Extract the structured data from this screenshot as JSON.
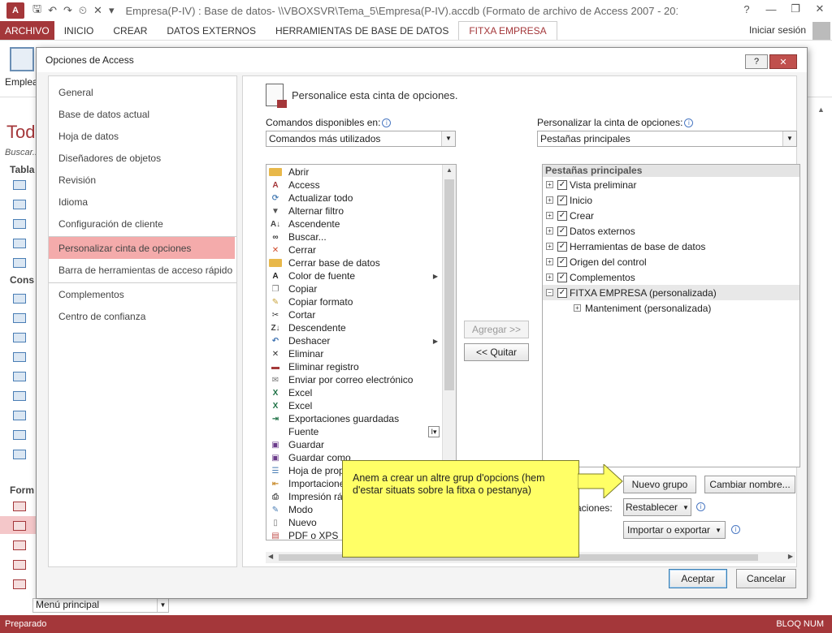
{
  "titlebar": {
    "app_logo": "A",
    "title": "Empresa(P-IV) : Base de datos- \\\\VBOXSVR\\Tema_5\\Empresa(P-IV).accdb (Formato de archivo de Access 2007 - 2013) - A...",
    "window_buttons": [
      "?",
      "—",
      "❐",
      "✕"
    ]
  },
  "ribbon": {
    "tabs": [
      "ARCHIVO",
      "INICIO",
      "CREAR",
      "DATOS EXTERNOS",
      "HERRAMIENTAS DE BASE DE DATOS",
      "FITXA EMPRESA"
    ],
    "active_tab": "FITXA EMPRESA",
    "signin": "Iniciar sesión",
    "big_button_label": "Emplea"
  },
  "nav_pane": {
    "title": "Tod",
    "search_placeholder": "Buscar...",
    "groups": [
      "Tabla",
      "Cons",
      "Form"
    ],
    "bottom_field": "Menú principal"
  },
  "status": {
    "left": "Preparado",
    "right": "BLOQ NUM"
  },
  "dialog": {
    "title": "Opciones de Access",
    "help_button": "?",
    "close_button": "✕",
    "sidebar": [
      "General",
      "Base de datos actual",
      "Hoja de datos",
      "Diseñadores de objetos",
      "Revisión",
      "Idioma",
      "Configuración de cliente",
      "Personalizar cinta de opciones",
      "Barra de herramientas de acceso rápido",
      "Complementos",
      "Centro de confianza"
    ],
    "active_sidebar": "Personalizar cinta de opciones",
    "header": "Personalice esta cinta de opciones.",
    "commands_label": "Comandos disponibles en:",
    "commands_combo": "Comandos más utilizados",
    "customize_label": "Personalizar la cinta de opciones:",
    "customize_combo": "Pestañas principales",
    "commands": [
      {
        "label": "Abrir",
        "icon": "folder-icon"
      },
      {
        "label": "Access",
        "icon": "access-icon"
      },
      {
        "label": "Actualizar todo",
        "icon": "refresh-icon"
      },
      {
        "label": "Alternar filtro",
        "icon": "filter-icon"
      },
      {
        "label": "Ascendente",
        "icon": "sort-asc-icon"
      },
      {
        "label": "Buscar...",
        "icon": "binoculars-icon"
      },
      {
        "label": "Cerrar",
        "icon": "close-red-icon"
      },
      {
        "label": "Cerrar base de datos",
        "icon": "folder-close-icon"
      },
      {
        "label": "Color de fuente",
        "icon": "font-color-icon",
        "arrow": true
      },
      {
        "label": "Copiar",
        "icon": "copy-icon"
      },
      {
        "label": "Copiar formato",
        "icon": "format-painter-icon"
      },
      {
        "label": "Cortar",
        "icon": "scissors-icon"
      },
      {
        "label": "Descendente",
        "icon": "sort-desc-icon"
      },
      {
        "label": "Deshacer",
        "icon": "undo-icon",
        "arrow": true
      },
      {
        "label": "Eliminar",
        "icon": "delete-x-icon"
      },
      {
        "label": "Eliminar registro",
        "icon": "delete-record-icon"
      },
      {
        "label": "Enviar por correo electrónico",
        "icon": "email-icon"
      },
      {
        "label": "Excel",
        "icon": "excel-icon"
      },
      {
        "label": "Excel",
        "icon": "excel-icon"
      },
      {
        "label": "Exportaciones guardadas",
        "icon": "export-icon"
      },
      {
        "label": "Fuente",
        "icon": "font-icon"
      },
      {
        "label": "Guardar",
        "icon": "save-icon"
      },
      {
        "label": "Guardar como",
        "icon": "save-as-icon"
      },
      {
        "label": "Hoja de prop",
        "icon": "property-sheet-icon"
      },
      {
        "label": "Importacione",
        "icon": "import-icon"
      },
      {
        "label": "Impresión ráp",
        "icon": "quick-print-icon"
      },
      {
        "label": "Modo",
        "icon": "mode-icon"
      },
      {
        "label": "Nuevo",
        "icon": "new-icon"
      },
      {
        "label": "PDF o XPS",
        "icon": "pdf-icon"
      }
    ],
    "tabs_tree_header": "Pestañas principales",
    "tabs_tree": [
      {
        "label": "Vista preliminar",
        "checked": true,
        "expand": "+"
      },
      {
        "label": "Inicio",
        "checked": true,
        "expand": "+"
      },
      {
        "label": "Crear",
        "checked": true,
        "expand": "+"
      },
      {
        "label": "Datos externos",
        "checked": true,
        "expand": "+"
      },
      {
        "label": "Herramientas de base de datos",
        "checked": true,
        "expand": "+"
      },
      {
        "label": "Origen del control",
        "checked": true,
        "expand": "+"
      },
      {
        "label": "Complementos",
        "checked": true,
        "expand": "+"
      },
      {
        "label": "FITXA EMPRESA (personalizada)",
        "checked": true,
        "expand": "−",
        "selected": true
      },
      {
        "label": "Manteniment (personalizada)",
        "expand": "+",
        "child": true
      }
    ],
    "add_button": "Agregar >>",
    "remove_button": "<< Quitar",
    "new_group_button": "Nuevo grupo",
    "rename_button": "Cambiar nombre...",
    "customizations_label": "aciones:",
    "reset_button": "Restablecer",
    "import_export_button": "Importar o exportar",
    "ok_button": "Aceptar",
    "cancel_button": "Cancelar"
  },
  "callout": {
    "text": "Anem a crear un altre grup d'opcions (hem d'estar situats sobre la fitxa o pestanya)",
    "color": "#ffff66"
  },
  "colors": {
    "accent": "#a4373a",
    "selected_sidebar": "#f4abab"
  }
}
